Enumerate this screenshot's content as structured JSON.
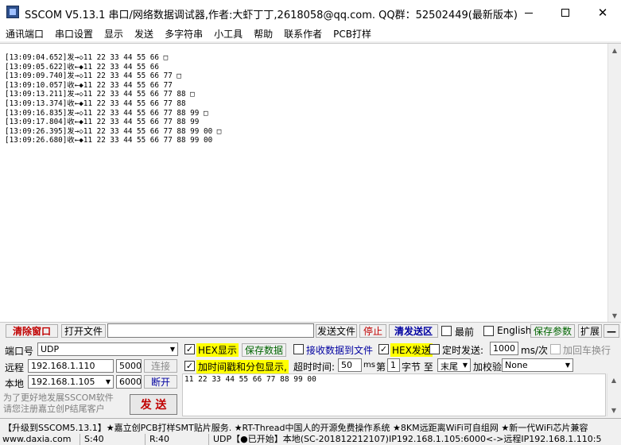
{
  "window": {
    "title": "SSCOM V5.13.1 串口/网络数据调试器,作者:大虾丁丁,2618058@qq.com. QQ群：52502449(最新版本)",
    "minimize_icon": "minimize-icon",
    "maximize_icon": "maximize-icon",
    "close_icon": "close-icon"
  },
  "menu": [
    "通讯端口",
    "串口设置",
    "显示",
    "发送",
    "多字符串",
    "小工具",
    "帮助",
    "联系作者",
    "PCB打样"
  ],
  "receive_log": [
    "[13:09:04.652]发→◇11 22 33 44 55 66 □",
    "[13:09:05.622]收←◆11 22 33 44 55 66",
    "[13:09:09.740]发→◇11 22 33 44 55 66 77 □",
    "[13:09:10.057]收←◆11 22 33 44 55 66 77",
    "[13:09:13.211]发→◇11 22 33 44 55 66 77 88 □",
    "[13:09:13.374]收←◆11 22 33 44 55 66 77 88",
    "[13:09:16.835]发→◇11 22 33 44 55 66 77 88 99 □",
    "[13:09:17.804]收←◆11 22 33 44 55 66 77 88 99",
    "[13:09:26.395]发→◇11 22 33 44 55 66 77 88 99 00 □",
    "[13:09:26.680]收←◆11 22 33 44 55 66 77 88 99 00"
  ],
  "toolbar": {
    "clear_window": "清除窗口",
    "open_file": "打开文件",
    "file_path": "",
    "send_file": "发送文件",
    "stop": "停止",
    "clear_send": "清发送区",
    "top_most": "最前",
    "english": "English",
    "save_params": "保存参数",
    "expand": "扩展",
    "collapse": "—"
  },
  "config": {
    "port_label": "端口号",
    "port_value": "UDP",
    "remote_label": "远程",
    "remote_ip": "192.168.1.110",
    "remote_port": "5000",
    "connect": "连接",
    "local_label": "本地",
    "local_ip": "192.168.1.105",
    "local_port": "6000",
    "disconnect": "断开",
    "promo_line1": "为了更好地发展SSCOM软件",
    "promo_line2": "请您注册嘉立创P结尾客户",
    "send_button": "发 送"
  },
  "options": {
    "hex_display": "HEX显示",
    "save_data": "保存数据",
    "recv_to_file": "接收数据到文件",
    "hex_send": "HEX发送",
    "timed_send": "定时发送:",
    "interval": "1000",
    "interval_unit": "ms/次",
    "add_crlf": "加回车换行",
    "timestamp": "加时间戳和分包显示,",
    "timeout_label": "超时时间:",
    "timeout_value": "50",
    "timeout_unit": "ms",
    "page_label": "第",
    "byte_index": "1",
    "byte_label": "字节 至",
    "end_option": "末尾",
    "checksum_label": "加校验",
    "checksum_value": "None"
  },
  "send_text": "11 22 33 44 55 66 77 88 99 00",
  "promo_bar": "【升级到SSCOM5.13.1】★嘉立创PCB打样SMT贴片服务. ★RT-Thread中国人的开源免费操作系统 ★8KM远距离WiFi可自组网 ★新一代WiFi芯片兼容",
  "status": {
    "website": "www.daxia.com",
    "sent": "S:40",
    "received": "R:40",
    "info": "UDP【●已开始】本地(SC-201812212107)IP192.168.1.105:6000<->远程IP192.168.1.110:5"
  }
}
